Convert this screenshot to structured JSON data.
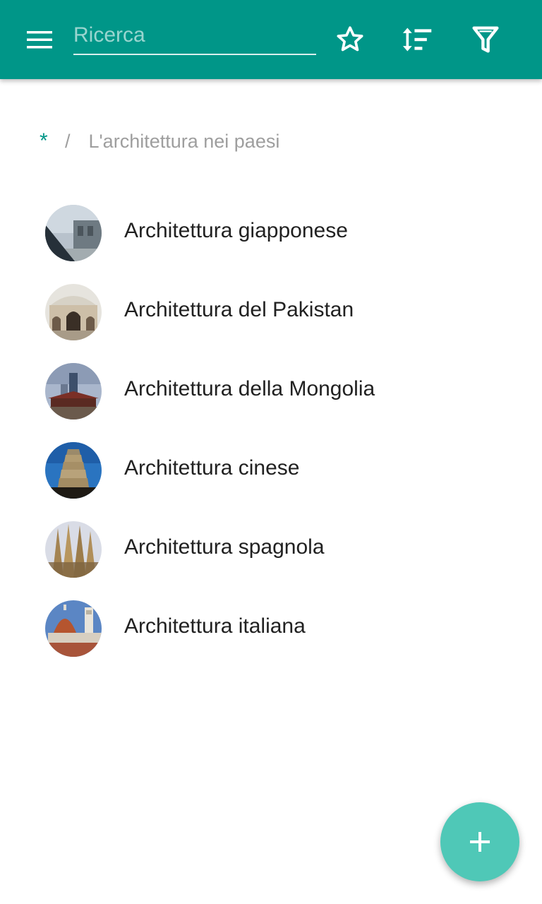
{
  "toolbar": {
    "background": "#009688",
    "menu_icon": "menu-icon",
    "search_placeholder": "Ricerca",
    "search_value": "",
    "favorite_icon": "star-outline-icon",
    "sort_icon": "sort-icon",
    "filter_icon": "filter-icon"
  },
  "breadcrumb": {
    "root": "*",
    "separator": "/",
    "current": "L'architettura nei paesi"
  },
  "list": {
    "items": [
      {
        "label": "Architettura giapponese",
        "thumbnail": "japanese-architecture-photo"
      },
      {
        "label": "Architettura del Pakistan",
        "thumbnail": "pakistan-architecture-photo"
      },
      {
        "label": "Architettura della Mongolia",
        "thumbnail": "mongolia-architecture-photo"
      },
      {
        "label": "Architettura cinese",
        "thumbnail": "chinese-pagoda-photo"
      },
      {
        "label": "Architettura spagnola",
        "thumbnail": "sagrada-familia-photo"
      },
      {
        "label": "Architettura italiana",
        "thumbnail": "florence-duomo-photo"
      }
    ]
  },
  "fab": {
    "icon": "plus-icon",
    "color": "#4fc8b7"
  }
}
